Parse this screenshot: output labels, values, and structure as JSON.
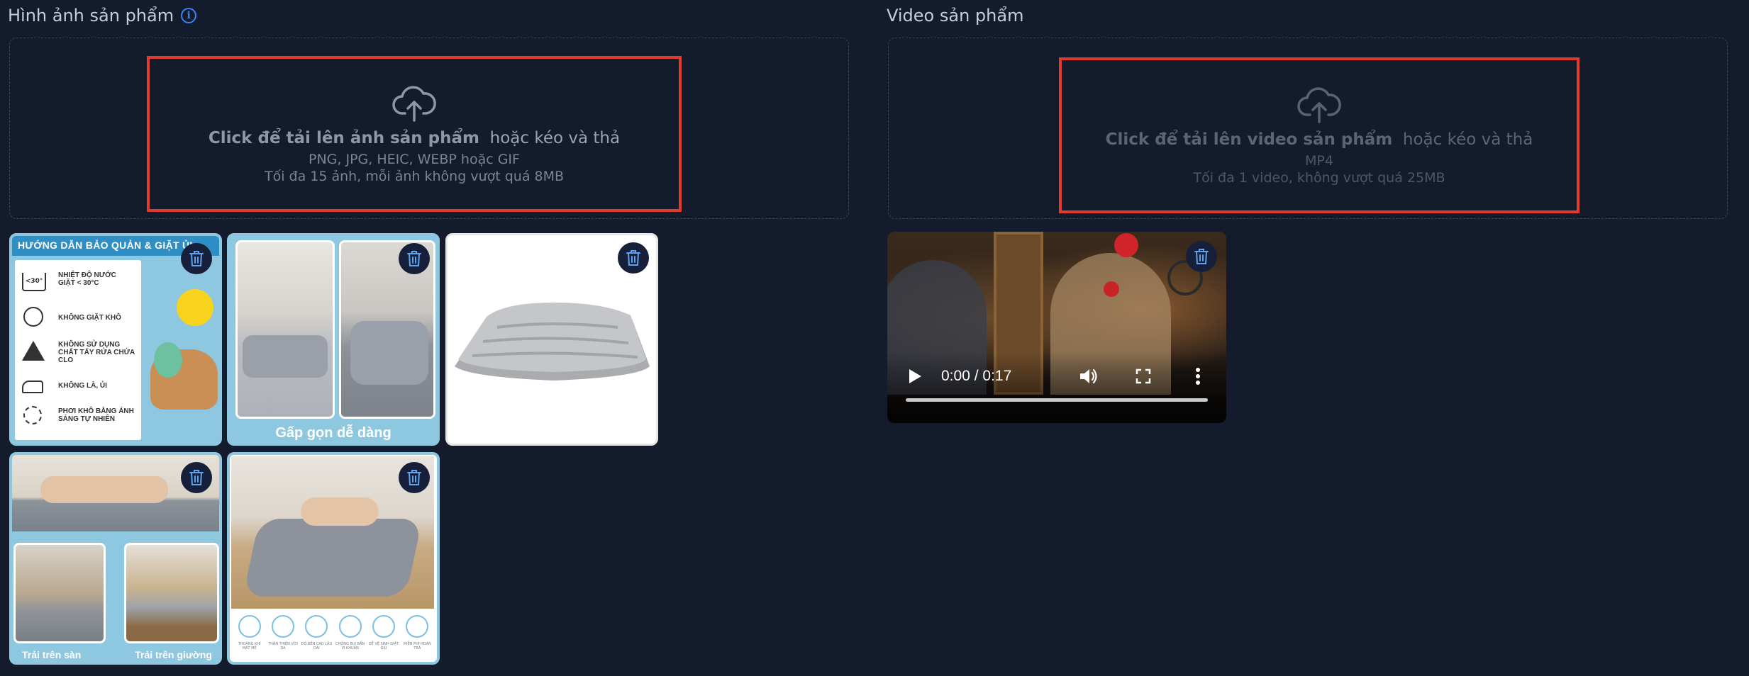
{
  "images_section": {
    "title": "Hình ảnh sản phẩm",
    "info_icon": "info-icon",
    "upload": {
      "icon": "cloud-upload-icon",
      "cta_strong": "Click để tải lên ảnh sản phẩm",
      "cta_rest": "hoặc kéo và thả",
      "formats": "PNG, JPG, HEIC, WEBP hoặc GIF",
      "limit": "Tối đa 15 ảnh, mỗi ảnh không vượt quá 8MB"
    },
    "images": [
      {
        "alt": "care-instructions",
        "title": "HƯỚNG DẪN BẢO QUẢN & GIẶT ỦI",
        "labels": [
          "NHIỆT ĐỘ NƯỚC GIẶT < 30°C",
          "KHÔNG GIẶT KHÔ",
          "KHÔNG SỬ DỤNG CHẤT TẨY RỬA CHỨA CLO",
          "KHÔNG LÀ, ỦI",
          "PHƠI KHÔ BẰNG ÁNH SÁNG TỰ NHIÊN"
        ],
        "badge": "<30°"
      },
      {
        "alt": "folding",
        "caption": "Gấp gọn dễ dàng"
      },
      {
        "alt": "mattress-white"
      },
      {
        "alt": "usage",
        "caption_left": "Trải trên sàn",
        "caption_right": "Trải trên giường"
      },
      {
        "alt": "lying-on-mattress",
        "features": [
          "THOÁNG KHÍ MẶT MỀ",
          "THÂN THIỆN VỚI DA",
          "ĐỘ BỀN CAO LÂU DÀI",
          "CHỐNG BỤI BẨN VI KHUẨN",
          "DỄ VỆ SINH GIẶT GIŨ",
          "MIỄN PHÍ HOÀN TRẢ"
        ]
      }
    ],
    "delete_icon": "trash-icon"
  },
  "video_section": {
    "title": "Video sản phẩm",
    "upload": {
      "icon": "cloud-upload-icon",
      "cta_strong": "Click để tải lên video sản phẩm",
      "cta_rest": "hoặc kéo và thả",
      "formats": "MP4",
      "limit": "Tối đa 1 video, không vượt quá 25MB"
    },
    "player": {
      "time": "0:00 / 0:17",
      "progress": 0
    }
  },
  "colors": {
    "background": "#141b2d",
    "highlight": "#e03b2f",
    "accent_blue": "#3b82f6",
    "thumb_bg": "#8ec8e0"
  }
}
